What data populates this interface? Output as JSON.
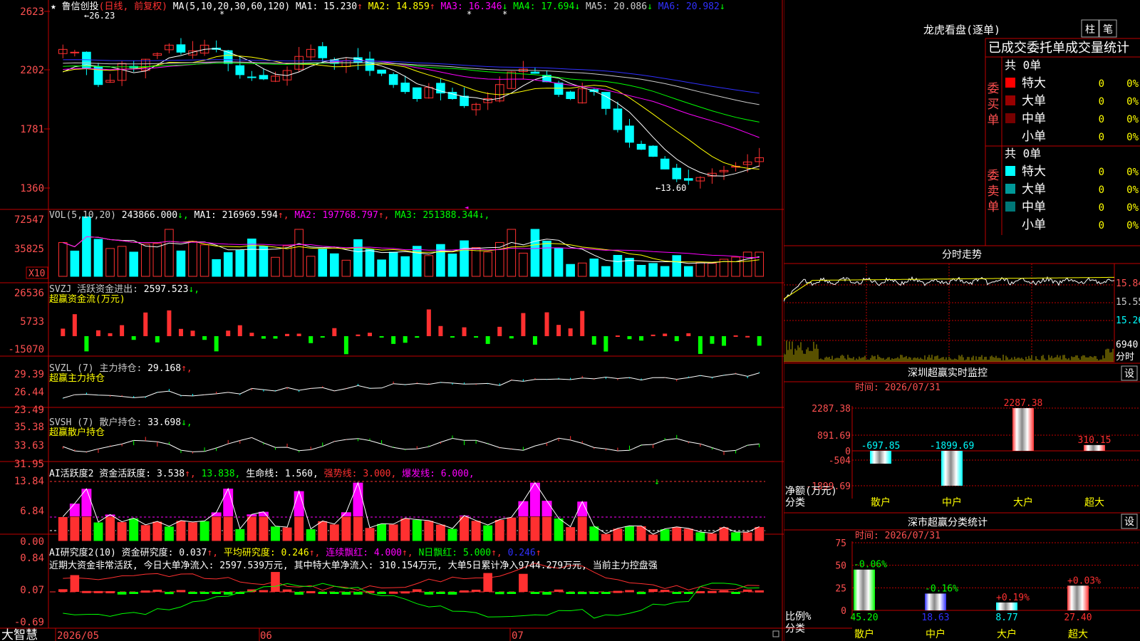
{
  "colors": {
    "up": "#ff3030",
    "down": "#00ffff",
    "grid": "#c00000",
    "axis_text": "#ff5050",
    "green": "#00ff00",
    "magenta": "#ff00ff",
    "yellow": "#ffff00",
    "white": "#ffffff",
    "blue": "#3030ff"
  },
  "price_panel": {
    "stock_name": "★ 鲁信创投",
    "stock_mode": "(日线, 前复权)",
    "ma_header": "MA(5,10,20,30,60,120)",
    "ma_values": [
      {
        "label": "MA1:",
        "value": "15.230",
        "arrow": "↑",
        "color": "#ffffff"
      },
      {
        "label": "MA2:",
        "value": "14.859",
        "arrow": "↑",
        "color": "#ffff00"
      },
      {
        "label": "MA3:",
        "value": "16.346",
        "arrow": "↓",
        "color": "#ff00ff"
      },
      {
        "label": "MA4:",
        "value": "17.694",
        "arrow": "↓",
        "color": "#00ff00"
      },
      {
        "label": "MA5:",
        "value": "20.086",
        "arrow": "↓",
        "color": "#cccccc"
      },
      {
        "label": "MA6:",
        "value": "20.982",
        "arrow": "↓",
        "color": "#3030ff"
      }
    ],
    "y_ticks": [
      "2623",
      "2202",
      "1781",
      "1360"
    ],
    "high_label": "26.23",
    "low_label": "13.60"
  },
  "volume_panel": {
    "header": "VOL(5,10,20)",
    "value": "243866.000",
    "items": [
      {
        "label": "MA1:",
        "value": "216969.594",
        "arrow": "↑",
        "color": "#ffffff"
      },
      {
        "label": "MA2:",
        "value": "197768.797",
        "arrow": "↑",
        "color": "#ff00ff"
      },
      {
        "label": "MA3:",
        "value": "251388.344",
        "arrow": "↓",
        "color": "#00ff00"
      }
    ],
    "y_ticks": [
      "72547",
      "35825"
    ],
    "unit": "X10"
  },
  "svzj_panel": {
    "header": "SVZJ  活跃资金进出:",
    "value": "2597.523",
    "sub": "超赢资金流(万元)",
    "y_ticks": [
      "26536",
      "5733",
      "-15070"
    ]
  },
  "svzl_panel": {
    "header": "SVZL (7) 主力持仓:",
    "value": "29.168",
    "sub": "超赢主力持仓",
    "y_ticks": [
      "29.39",
      "26.44",
      "23.49"
    ]
  },
  "svsh_panel": {
    "header": "SVSH (7) 散户持仓:",
    "value": "33.698",
    "sub": "超赢散户持仓",
    "y_ticks": [
      "35.38",
      "33.63",
      "31.95"
    ]
  },
  "ai_active_panel": {
    "header": "AI活跃度2 资金活跃度:",
    "value": "3.538",
    "v2": "13.838",
    "life_label": "生命线:",
    "life_value": "1.560",
    "strong": "强势线: 3.000,",
    "burst": "爆发线: 6.000,",
    "y_ticks": [
      "13.84",
      "6.84",
      "0.00"
    ]
  },
  "ai_research_panel": {
    "header": "AI研究度2(10) 资金研究度:",
    "value": "0.037",
    "avg": "平均研究度: 0.246",
    "lianxu": "连续飘红: 4.000",
    "nday": "N日飘红: 5.000",
    "last": "0.246",
    "comment": "近期大资金非常活跃, 今日大单净流入: 2597.539万元, 其中特大单净流入: 310.154万元, 大单5日累计净入9744.279万元, 当前主力控盘强",
    "y_ticks": [
      "0.84",
      "0.07",
      "-0.69"
    ]
  },
  "bottom_bar": {
    "brand": "大智慧",
    "dates": [
      "2026/05",
      "06",
      "07"
    ]
  },
  "right": {
    "longhu_title": "龙虎看盘(逐单)",
    "btn_zhu": "柱",
    "btn_bi": "笔",
    "stats_title": "已成交委托单成交量统计",
    "buy_label": "委买单",
    "sell_label": "委卖单",
    "buy_total": "共 0单",
    "sell_total": "共 0单",
    "buy_rows": [
      {
        "label": "特大",
        "count": "0",
        "pct": "0%",
        "color": "#ff0000"
      },
      {
        "label": "大单",
        "count": "0",
        "pct": "0%",
        "color": "#990000"
      },
      {
        "label": "中单",
        "count": "0",
        "pct": "0%",
        "color": "#770000"
      },
      {
        "label": "小单",
        "count": "0",
        "pct": "0%",
        "color": ""
      }
    ],
    "sell_rows": [
      {
        "label": "特大",
        "count": "0",
        "pct": "0%",
        "color": "#00ffff"
      },
      {
        "label": "大单",
        "count": "0",
        "pct": "0%",
        "color": "#009999"
      },
      {
        "label": "中单",
        "count": "0",
        "pct": "0%",
        "color": "#007777"
      },
      {
        "label": "小单",
        "count": "0",
        "pct": "0%",
        "color": ""
      }
    ],
    "fenshi_title": "分时走势",
    "fenshi_ticks": [
      "15.84",
      "15.55",
      "15.26"
    ],
    "fenshi_vol": "6940",
    "fenshi_vol_label": "分时",
    "monitor_title": "深圳超赢实时监控",
    "monitor_btn": "设",
    "monitor_time": "时间: 2026/07/31",
    "monitor_ticks": [
      "2287.38",
      "891.69",
      "0",
      "-504",
      "-1899.69"
    ],
    "monitor_ylabel": "净额(万元)",
    "monitor_xlabel": "分类",
    "monitor_bars": [
      {
        "name": "散户",
        "value": -697.85,
        "label": "-697.85",
        "color": "#00ffff"
      },
      {
        "name": "中户",
        "value": -1899.69,
        "label": "-1899.69",
        "color": "#00ffff"
      },
      {
        "name": "大户",
        "value": 2287.38,
        "label": "2287.38",
        "color": "#ff3030"
      },
      {
        "name": "超大",
        "value": 310.15,
        "label": "310.15",
        "color": "#ff3030"
      }
    ],
    "class_title": "深市超赢分类统计",
    "class_btn": "设",
    "class_time": "时间: 2026/07/31",
    "class_ticks": [
      "75",
      "50",
      "25",
      "0"
    ],
    "class_ylabel": "比例%",
    "class_xlabel": "分类",
    "class_bars": [
      {
        "name": "散户",
        "value": 45.2,
        "label": "45.20",
        "change": "-0.06%",
        "color": "#00ff00",
        "change_color": "#00ff00"
      },
      {
        "name": "中户",
        "value": 18.63,
        "label": "18.63",
        "change": "-0.16%",
        "color": "#3030ff",
        "change_color": "#00ff00"
      },
      {
        "name": "大户",
        "value": 8.77,
        "label": "8.77",
        "change": "+0.19%",
        "color": "#00ffff",
        "change_color": "#ff3030"
      },
      {
        "name": "超大",
        "value": 27.4,
        "label": "27.40",
        "change": "+0.03%",
        "color": "#ff3030",
        "change_color": "#ff3030"
      }
    ]
  }
}
